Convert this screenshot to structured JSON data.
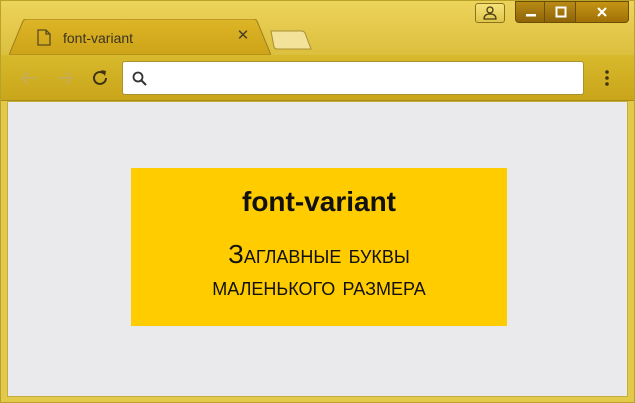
{
  "browser": {
    "tab": {
      "title": "font-variant",
      "close_glyph": "✕",
      "favicon": "page-icon"
    },
    "new_tab": "new-tab-icon",
    "window_controls": {
      "profile": "person-icon",
      "minimize": "minimize-icon",
      "maximize": "maximize-icon",
      "close": "close-icon"
    },
    "toolbar": {
      "back": "back-arrow-icon",
      "forward": "forward-arrow-icon",
      "reload": "reload-icon",
      "omnibox_value": "",
      "search": "search-icon",
      "menu": "kebab-menu-icon"
    },
    "colors": {
      "frame": "#e3c94a",
      "controls": "#a57a0c",
      "page_background": "#eae9ec",
      "demo_background": "#ffcc00"
    }
  },
  "page": {
    "heading": "font-variant",
    "text_line1": "Заглавные буквы",
    "text_line2": "маленького размера"
  }
}
